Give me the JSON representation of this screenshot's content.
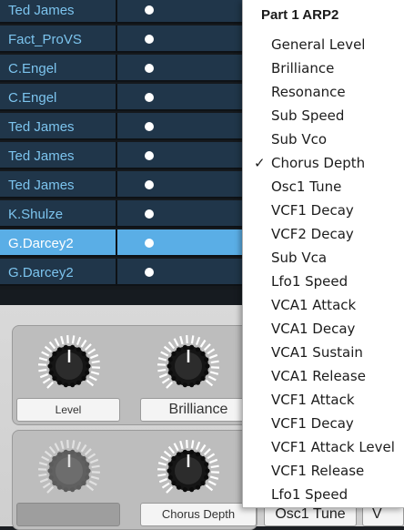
{
  "list": {
    "rows": [
      {
        "name": "Ted James",
        "selected": false
      },
      {
        "name": "Fact_ProVS",
        "selected": false
      },
      {
        "name": "C.Engel",
        "selected": false
      },
      {
        "name": "C.Engel",
        "selected": false
      },
      {
        "name": "Ted James",
        "selected": false
      },
      {
        "name": "Ted James",
        "selected": false
      },
      {
        "name": "Ted James",
        "selected": false
      },
      {
        "name": "K.Shulze",
        "selected": false
      },
      {
        "name": "G.Darcey2",
        "selected": true
      },
      {
        "name": "G.Darcey2",
        "selected": false
      }
    ]
  },
  "controls": {
    "group1": {
      "knob1_label": "Level",
      "knob2_label": "Brilliance"
    },
    "group2": {
      "knob1_label": "",
      "knob2_label": "Chorus Depth",
      "extra_button_1": "Osc1 Tune",
      "extra_button_2": "V"
    }
  },
  "menu": {
    "title": "Part 1 ARP2",
    "checked_item": "Chorus Depth",
    "items": [
      "General Level",
      "Brilliance",
      "Resonance",
      "Sub Speed",
      "Sub Vco",
      "Chorus Depth",
      "Osc1 Tune",
      "VCF1 Decay",
      "VCF2 Decay",
      "Sub Vca",
      "Lfo1 Speed",
      "VCA1 Attack",
      "VCA1 Decay",
      "VCA1 Sustain",
      "VCA1 Release",
      "VCF1 Attack",
      "VCF1 Decay",
      "VCF1 Attack Level",
      "VCF1 Release",
      "Lfo1 Speed"
    ]
  },
  "colors": {
    "row_bg": "#20364a",
    "row_selected_bg": "#5aaee6",
    "row_text": "#7cc4ee"
  },
  "icons": {
    "status_dot": "status-dot-icon",
    "checkmark": "checkmark-icon",
    "knob": "rotary-knob-icon"
  }
}
